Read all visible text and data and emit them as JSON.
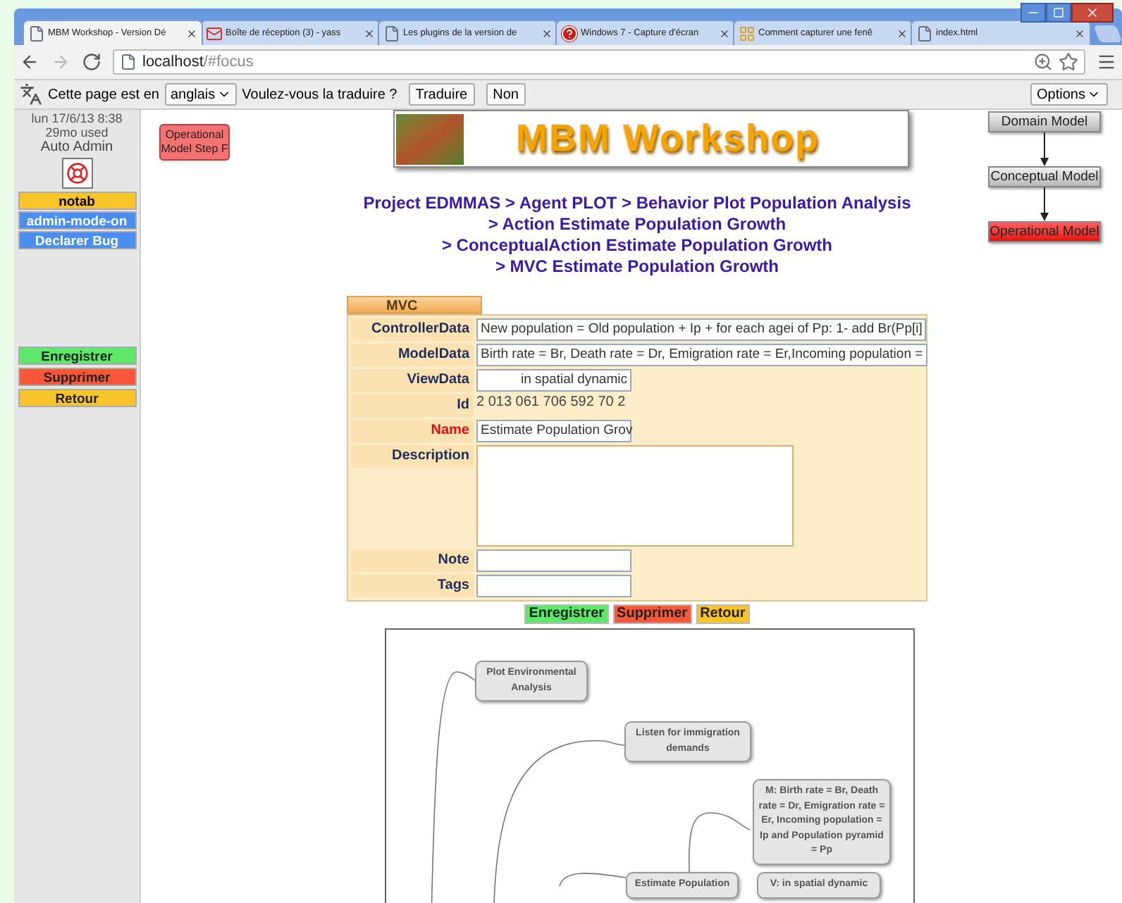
{
  "browser": {
    "tabs": [
      {
        "title": "MBM Workshop - Version Dé",
        "kind": "page",
        "selected": true
      },
      {
        "title": "Boîte de réception (3) - yass",
        "kind": "mail",
        "selected": false
      },
      {
        "title": "Les plugins de la version de",
        "kind": "page",
        "selected": false
      },
      {
        "title": "Windows 7 - Capture d'écran",
        "kind": "help",
        "selected": false
      },
      {
        "title": "Comment capturer une fenê",
        "kind": "grid",
        "selected": false
      },
      {
        "title": "index.html",
        "kind": "page",
        "selected": false
      }
    ],
    "url_host": "localhost",
    "url_path": "/#focus"
  },
  "translate_bar": {
    "text_before": "Cette page est en",
    "language": "anglais",
    "question": "Voulez-vous la traduire ?",
    "buttons": [
      "Traduire",
      "Non"
    ],
    "options": "Options"
  },
  "sidebar": {
    "date": "lun 17/6/13 8:38",
    "usage": "29mo used",
    "user": "Auto Admin",
    "top_buttons": [
      {
        "label": "notab",
        "color": "#f9c32a"
      },
      {
        "label": "admin-mode-on",
        "color": "#4a8ff0"
      },
      {
        "label": "Declarer Bug",
        "color": "#4a8ff0"
      }
    ],
    "bottom_buttons": [
      {
        "label": "Enregistrer",
        "color": "#5ee86a"
      },
      {
        "label": "Supprimer",
        "color": "#f9573a"
      },
      {
        "label": "Retour",
        "color": "#f9c32a"
      }
    ]
  },
  "step_badge": "Operational Model Step F",
  "banner_title": "MBM Workshop",
  "model_flow": [
    {
      "label": "Domain Model",
      "selected": false
    },
    {
      "label": "Conceptual Model",
      "selected": false
    },
    {
      "label": "Operational Model",
      "selected": true
    }
  ],
  "breadcrumb": [
    "Project EDMMAS > Agent PLOT > Behavior Plot Population Analysis",
    "> Action Estimate Population Growth",
    "> ConceptualAction Estimate Population Growth",
    "> MVC Estimate Population Growth"
  ],
  "form": {
    "tab": "MVC",
    "fields": [
      {
        "label": "ControllerData",
        "kind": "wide",
        "value": "New population = Old population + Ip + for each agei of Pp: 1- add Br(Pp[i]",
        "highlighted": false
      },
      {
        "label": "ModelData",
        "kind": "wide",
        "value": "Birth rate = Br, Death rate = Dr, Emigration rate = Er,Incoming population =",
        "highlighted": false
      },
      {
        "label": "ViewData",
        "kind": "short",
        "value": "in spatial dynamic",
        "highlighted": false
      },
      {
        "label": "Id",
        "kind": "text",
        "value": "2 013 061 706 592 70 2",
        "highlighted": false
      },
      {
        "label": "Name",
        "kind": "short",
        "value": "Estimate Population Grov",
        "highlighted": true
      },
      {
        "label": "Description",
        "kind": "textarea",
        "highlighted": false
      },
      {
        "label": "Note",
        "kind": "short",
        "highlighted": false
      },
      {
        "label": "Tags",
        "kind": "short",
        "highlighted": false
      }
    ],
    "buttons": [
      {
        "label": "Enregistrer",
        "color": "#5ee86a"
      },
      {
        "label": "Supprimer",
        "color": "#f9573a"
      },
      {
        "label": "Retour",
        "color": "#f9c32a"
      }
    ]
  },
  "diagram": {
    "nodes": [
      "Plot Environmental Analysis",
      "Listen for immigration demands",
      "M: Birth rate = Br, Death rate = Dr, Emigration rate = Er, Incoming population = Ip and Population pyramid = Pp",
      "Estimate Population",
      "V: in spatial dynamic"
    ]
  }
}
